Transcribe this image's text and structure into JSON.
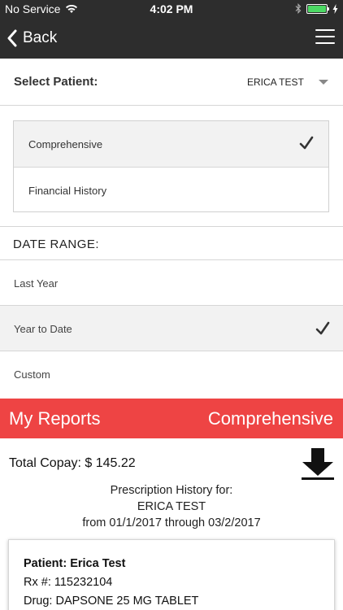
{
  "status_bar": {
    "carrier": "No Service",
    "time": "4:02 PM",
    "battery_color": "#4cd964"
  },
  "nav": {
    "back_label": "Back",
    "back_icon": "chevron-left-icon",
    "menu_icon": "hamburger-menu-icon"
  },
  "patient_select": {
    "label": "Select Patient:",
    "value": "ERICA TEST"
  },
  "report_types": [
    {
      "label": "Comprehensive",
      "selected": true
    },
    {
      "label": "Financial History",
      "selected": false
    }
  ],
  "date_range": {
    "heading": "DATE RANGE:",
    "options": [
      {
        "label": "Last Year",
        "selected": false
      },
      {
        "label": "Year to Date",
        "selected": true
      },
      {
        "label": "Custom",
        "selected": false
      }
    ]
  },
  "reports_bar": {
    "title": "My Reports",
    "type": "Comprehensive",
    "color": "#ee4444"
  },
  "summary": {
    "total_copay": "Total Copay: $ 145.22",
    "history_title": "Prescription History for:",
    "patient_name": "ERICA TEST",
    "range_text": "from 01/1/2017 through 03/2/2017"
  },
  "record": {
    "patient": "Patient: Erica Test",
    "rx": "Rx #: 115232104",
    "drug": "Drug: DAPSONE 25 MG TABLET"
  }
}
